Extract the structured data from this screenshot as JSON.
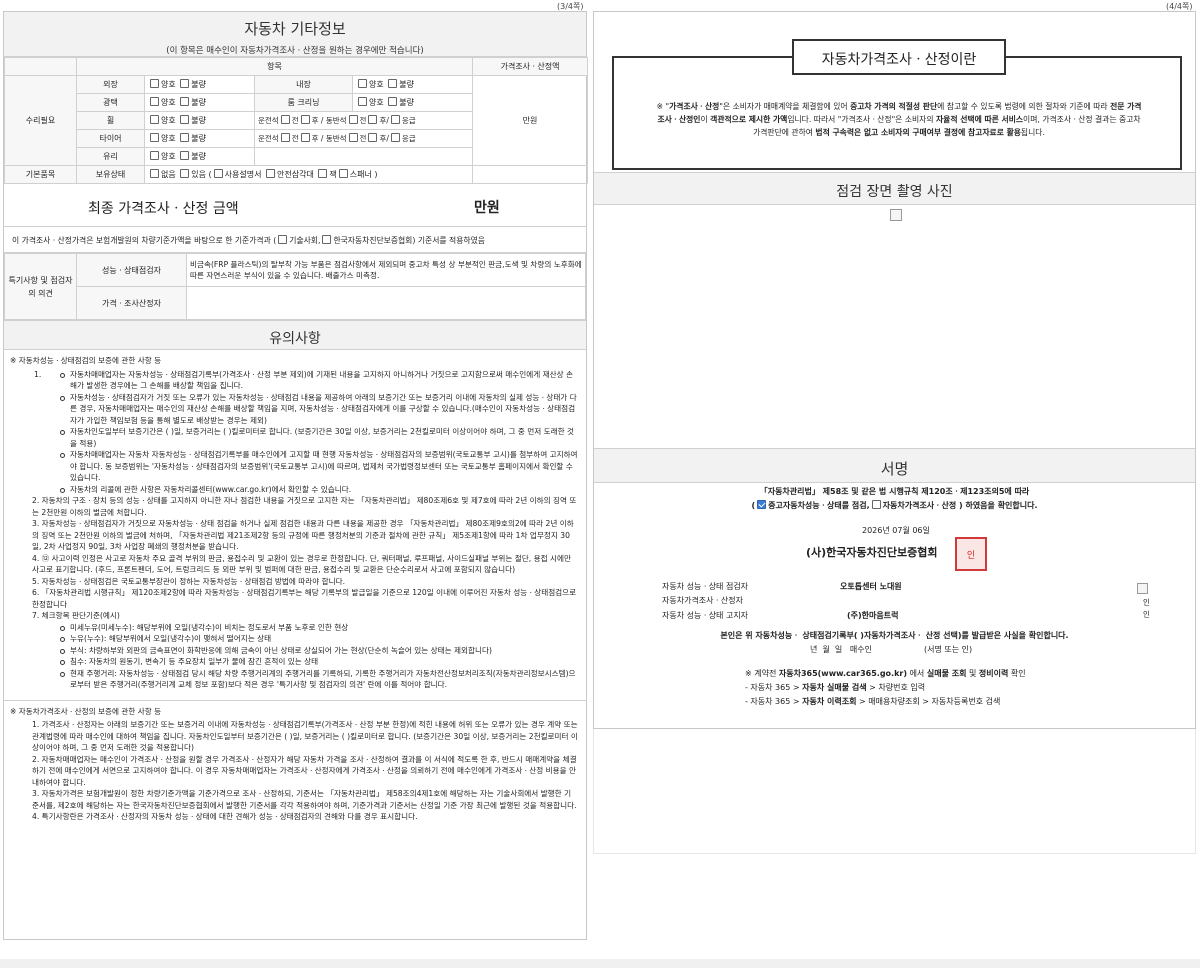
{
  "page_numbers": {
    "left": "(3/4쪽)",
    "right": "(4/4쪽)"
  },
  "left": {
    "other_info": {
      "title": "자동차 기타정보",
      "subtitle": "(이 항목은 매수인이 자동차가격조사ㆍ산정을 원하는 경우에만 적습니다)",
      "col_items": "항목",
      "col_price": "가격조사ㆍ산정액",
      "repair_label": "수리필요",
      "basic_label": "기본품목",
      "price_value": "만원",
      "good": "양호",
      "bad": "불량",
      "exterior": "외장",
      "interior": "내장",
      "gloss": "광택",
      "room_cleaning": "룸 크리닝",
      "wheel": "휠",
      "tire": "타이어",
      "glass": "유리",
      "wheel_pos": {
        "d": "운전석",
        "f": "전",
        "r": "후",
        "sep": "/",
        "p": "동반석",
        "e": "응급"
      },
      "possession": "보유상태",
      "none": "없음",
      "have": "있음 (",
      "manual": "사용설명서",
      "triangle": "안전삼각대",
      "jack": "잭",
      "spanner": "스패너 )"
    },
    "final": {
      "title": "최종 가격조사ㆍ산정 금액",
      "value": "만원",
      "basis_pre": "이 가격조사ㆍ산정가격은 보험개발원의 차량기준가액을 바탕으로 한 기준가격과 (",
      "basis_opt1": "기술사회,",
      "basis_opt2": "한국자동차진단보증협회) 기준서를 적용하였음"
    },
    "opinion": {
      "label": "특기사항 및 점검자의 의견",
      "row1": "성능ㆍ상태점검자",
      "row1_text": "비금속(FRP 플라스틱)의 탈부착 가능 부품은 점검사항에서 제외되며 중고차 특성 상 부분적인 판금,도색 및 차량의 노후화에 따른 자연스러운 부식이 있을 수 있습니다. 배출가스 미측정.",
      "row2": "가격ㆍ조사산정자"
    },
    "notice": {
      "title": "유의사항",
      "s1_head": "※ 자동차성능ㆍ상태점검의 보증에 관한 사항 등",
      "s1_n1": "1.",
      "s1_b1": "자동차매매업자는 자동차성능ㆍ상태점검기록부(가격조사ㆍ산정 부분 제외)에 기재된 내용을 고지하지 아니하거나 거짓으로 고지함으로써 매수인에게 재산상 손해가 발생한 경우에는 그 손해를 배상할 책임을 집니다.",
      "s1_b2": "자동차성능ㆍ상태점검자가 거짓 또는 오류가 있는 자동차성능ㆍ상태점검 내용을 제공하여 아래의 보증기간 또는 보증거리 이내에 자동차의 실제 성능ㆍ상태가 다른 경우, 자동차매매업자는 매수인의 재산상 손해를 배상할 책임을 지며, 자동차성능ㆍ상태점검자에게 이를 구상할 수 있습니다.(매수인이 자동차성능ㆍ상태점검자가 가입한 책임보험 등을 통해 별도로 배상받는 경우는 제외)",
      "s1_b3": "자동차인도일부터 보증기간은 (      )일, 보증거리는 (      )킬로미터로 합니다. (보증기간은 30일 이상, 보증거리는 2천킬로미터 이상이어야 하며, 그 중 먼저 도래한 것을 적용)",
      "s1_b4": "자동차매매업자는 자동차 자동차성능ㆍ상태점검기록부를 매수인에게 고지할 때 현행 자동차성능ㆍ상태점검자의 보증범위(국토교통부 고시)를 첨부하여 고지하여야 합니다. 동 보증범위는 '자동차성능ㆍ상태점검자의 보증범위'(국토교통부 고시)에 따르며, 법제처 국가법령정보센터 또는 국토교통부 홈페이지에서 확인할 수 있습니다.",
      "s1_b5": "자동차의 리콜에 관한 사항은 자동차리콜센터(www.car.go.kr)에서 확인할 수 있습니다.",
      "s1_2": "2. 자동차의 구조ㆍ장치 등의 성능ㆍ상태를 고지하지 아니한 자나 점검한 내용을 거짓으로 고지한 자는 「자동차관리법」 제80조제6호 및 제7호에 따라 2년 이하의 징역 또는 2천만원 이하의 벌금에 처합니다.",
      "s1_3": "3. 자동차성능ㆍ상태점검자가 거짓으로 자동차성능ㆍ상태 점검을 하거나 실제 점검한 내용과 다른 내용을 제공한 경우 「자동차관리법」 제80조제9호의2에 따라 2년 이하의 징역 또는 2천만원 이하의 벌금에 처하며, 「자동차관리법 제21조제2항 등의 규정에 따른 행정처분의 기준과 절차에 관한 규칙」 제5조제1항에 따라 1차 업무정지 30일, 2차 사업정지 90일, 3차 사업장 폐쇄의 행정처분을 받습니다.",
      "s1_4": "4. ⑫ 사고이력 인정은 사고로 자동차 주요 골격 부위의 판금, 용접수리 및 교환이 있는 경우로 한정합니다. 단, 쿼터패널, 루프패널, 사이드실패널 부위는 절단, 용접 시에만 사고로 표기합니다. (후드, 프론트펜더, 도어, 트렁크리드 등 외판 부위 및 범퍼에 대한 판금, 용접수리 및 교환은 단순수리로서 사고에 포함되지 않습니다)",
      "s1_5": "5. 자동차성능ㆍ상태점검은 국토교통부장관이 정하는 자동차성능ㆍ상태점검 방법에 따라야 합니다.",
      "s1_6": "6. 「자동차관리법 시행규칙」 제120조제2항에 따라 자동차성능ㆍ상태점검기록부는 해당 기록부의 발급일을 기준으로 120일 이내에 이루어진 자동차 성능ㆍ상태점검으로 한정합니다",
      "s1_7": "7. 체크항목 판단기준(예시)",
      "s1_7a": "미세누유(미세누수): 해당부위에 오일(냉각수)이 비치는 정도로서 부품 노후로 인한 현상",
      "s1_7b": "누유(누수): 해당부위에서 오일(냉각수)이 맺혀서 떨어지는 상태",
      "s1_7c": "부식: 차량하부와 외판의 금속표면이 화학반응에 의해 금속이 아닌 상태로 상실되어 가는 현상(단순히 녹슬어 있는 상태는 제외합니다)",
      "s1_7d": "침수: 자동차의 원동기, 변속기 등 주요장치 일부가 물에 잠긴 흔적이 있는 상태",
      "s1_7e": "현재 주행거리: 자동차성능ㆍ상태점검 당시 해당 차량 주행거리계의 주행거리를 기록하되, 기록한 주행거리가 자동차전산정보처리조직(자동차관리정보시스템)으로부터 받은 주행거리(주행거리계 교체 정보 포함)보다 적은 경우 '특기사항 및 점검자의 의견' 란에 이를 적어야 합니다.",
      "s2_head": "※ 자동차가격조사ㆍ산정의 보증에 관한 사항 등",
      "s2_1": "1. 가격조사ㆍ산정자는 아래의 보증기간 또는 보증거리 이내에 자동차성능ㆍ상태점검기록부(가격조사ㆍ산정 부분 한정)에 적힌 내용에 허위 또는 오류가 있는 경우 계약 또는 관계법령에 따라 매수인에 대하여 책임을 집니다.    자동차인도일부터 보증기간은 (      )일, 보증거리는 (      )킬로미터로 합니다. (보증기간은 30일 이상, 보증거리는 2천킬로미터 이상이어야 하며, 그 중 먼저 도래한 것을 적용합니다)",
      "s2_2": "2. 자동차매매업자는 매수인이 가격조사ㆍ산정을 원할 경우 가격조사ㆍ산정자가 해당 자동차 가격을 조사ㆍ산정하여 결과를 이 서식에 적도록 한 후, 반드시 매매계약을 체결하기 전에 매수인에게 서면으로 고지하여야 합니다. 이 경우 자동차매매업자는 가격조사ㆍ산정자에게 가격조사ㆍ산정을 의뢰하기 전에 매수인에게 가격조사ㆍ산정 비용을 안내하여야 합니다.",
      "s2_3": "3. 자동차가격은 보험개발원이 정한 차량기준가액을 기준가격으로 조사ㆍ산정하되, 기준서는 「자동차관리법」 제58조의4제1호에 해당하는 자는 기술사회에서 발행한 기준서를, 제2호에 해당하는 자는 한국자동차진단보증협회에서 발행한 기준서를 각각 적용하여야 하며, 기준가격과 기준서는 산정일 기준 가장 최근에 발행된 것을 적용합니다.",
      "s2_4": "4. 특기사항란은 가격조사ㆍ산정자의 자동차 성능ㆍ상태에 대한 견해가 성능ㆍ상태점검자의 견해와 다를 경우 표시합니다."
    }
  },
  "right": {
    "box": {
      "title": "자동차가격조사ㆍ산정이란",
      "p1": "※ \"",
      "p1b": "가격조사ㆍ산정",
      "p2": "\"은 소비자가 매매계약을 체결함에 있어 ",
      "p2b": "중고차 가격의 적절성 판단",
      "p3": "에 참고할 수 있도록 법령에 의한 절차와 기준에 따라 ",
      "p3b": "전문 가격조사ㆍ산정인",
      "p4": "이 ",
      "p4b": "객관적으로 제시한 가액",
      "p5": "입니다. 따라서 \"가격조사ㆍ산정\"은 소비자의 ",
      "p5b": "자율적 선택에 따른 서비스",
      "p6": "이며, 가격조사ㆍ산정 결과는 중고차 가격판단에 관하여 ",
      "p6b": "법적 구속력은 없고 소비자의 구매여부 결정에 참고자료로 활용",
      "p7": "됩니다."
    },
    "photo_title": "점검 장면 촬영 사진",
    "sign": {
      "title": "서명",
      "line1": "「자동차관리법」 제58조 및 같은 법 시행규칙 제120조ㆍ제123조의5에 따라",
      "line2a": "(",
      "line2b": "중고자동차성능ㆍ상태를 점검,",
      "line2c": "자동차가격조사ㆍ산정 ) 하였음을 확인합니다.",
      "date": "2026년 07월  06일",
      "org": "(사)한국자동차진단보증협회",
      "seal": "인",
      "r1_label": "자동차 성능ㆍ상태 점검자",
      "r1_value": "오토톱센터 노대원",
      "r2_label": "자동차가격조사ㆍ산정자",
      "r3_label": "자동차 성능ㆍ상태 고지자",
      "r3_value": "(주)한마음트럭",
      "stamp_a": "인",
      "stamp_b": "인",
      "confirm": "본인은 위 자동차성능ㆍ 상태점검기록부(  )자동차가격조사ㆍ 산정 선택)를 발급받은 사실을 확인합니다.",
      "buyer_date": "년  월  일   매수인",
      "buyer_sign": "(서명 또는 인)",
      "ref1a": "※ 계약전 ",
      "ref1b": "자동차365(www.car365.go.kr)",
      "ref1c": " 에서 ",
      "ref1d": "실매물 조회",
      "ref1e": " 및 ",
      "ref1f": "정비이력",
      "ref1g": " 확인",
      "ref2a": "- 자동차 365 > ",
      "ref2b": "자동차 실매물 검색",
      "ref2c": " > 차량번호 입력",
      "ref3a": "- 자동차 365 > ",
      "ref3b": "자동차 이력조회",
      "ref3c": " > 매매용차량조회 > 자동차등록번호 검색"
    }
  }
}
